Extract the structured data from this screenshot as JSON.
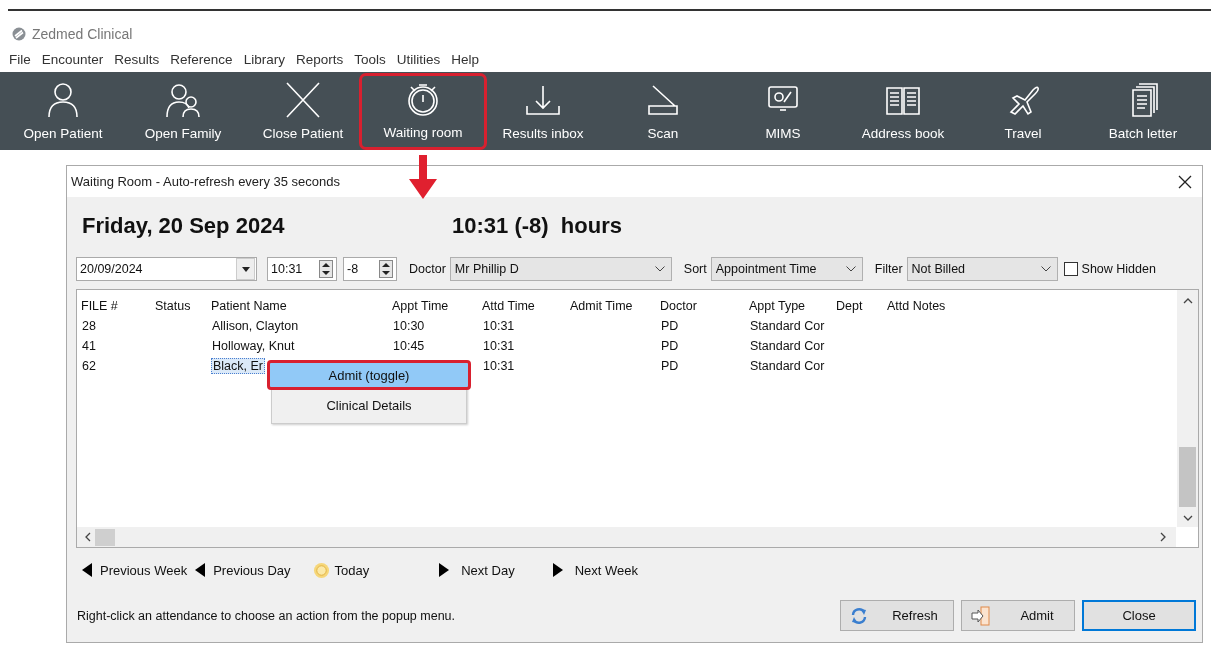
{
  "app": {
    "title": "Zedmed Clinical"
  },
  "menu": [
    "File",
    "Encounter",
    "Results",
    "Reference",
    "Library",
    "Reports",
    "Tools",
    "Utilities",
    "Help"
  ],
  "toolbar": [
    {
      "label": "Open Patient",
      "highlighted": false
    },
    {
      "label": "Open Family",
      "highlighted": false
    },
    {
      "label": "Close Patient",
      "highlighted": false
    },
    {
      "label": "Waiting room",
      "highlighted": true
    },
    {
      "label": "Results inbox",
      "highlighted": false
    },
    {
      "label": "Scan",
      "highlighted": false
    },
    {
      "label": "MIMS",
      "highlighted": false
    },
    {
      "label": "Address book",
      "highlighted": false
    },
    {
      "label": "Travel",
      "highlighted": false
    },
    {
      "label": "Batch letter",
      "highlighted": false
    }
  ],
  "dialog": {
    "title": "Waiting Room - Auto-refresh every 35 seconds",
    "date_heading": "Friday, 20 Sep 2024",
    "time_heading": "10:31 (-8)  hours",
    "date_field": {
      "value": "20/09/2024"
    },
    "time_field": {
      "value": "10:31"
    },
    "offset_field": {
      "value": "-8"
    },
    "doctor": {
      "label": "Doctor",
      "value": "Mr Phillip D"
    },
    "sort": {
      "label": "Sort",
      "value": "Appointment Time"
    },
    "filter": {
      "label": "Filter",
      "value": "Not Billed"
    },
    "show_hidden": {
      "label": "Show Hidden",
      "checked": false
    },
    "table": {
      "columns": [
        "FILE #",
        "Status",
        "Patient Name",
        "Appt Time",
        "Attd Time",
        "Admit Time",
        "Doctor",
        "Appt Type",
        "Dept",
        "Attd Notes"
      ],
      "rows": [
        {
          "file": "28",
          "patient_name": "Allison, Clayton",
          "appt_time": "10:30",
          "attd_time": "10:31",
          "doctor": "PD",
          "appt_type": "Standard Cor",
          "selected": false
        },
        {
          "file": "41",
          "patient_name": "Holloway, Knut",
          "appt_time": "10:45",
          "attd_time": "10:31",
          "doctor": "PD",
          "appt_type": "Standard Cor",
          "selected": false
        },
        {
          "file": "62",
          "patient_name": "Black, Er",
          "attd_time": "10:31",
          "doctor": "PD",
          "appt_type": "Standard Cor",
          "selected": true
        }
      ]
    },
    "context_menu": [
      {
        "label": "Admit (toggle)",
        "selected": true,
        "highlighted": true
      },
      {
        "label": "Clinical Details",
        "selected": false,
        "highlighted": false
      }
    ],
    "navigation": [
      {
        "label": "Previous Week",
        "kind": "back"
      },
      {
        "label": "Previous Day",
        "kind": "back"
      },
      {
        "label": "Today",
        "kind": "today"
      },
      {
        "label": "Next Day",
        "kind": "forward"
      },
      {
        "label": "Next Week",
        "kind": "forward"
      }
    ],
    "hint": "Right-click an attendance to choose an action from the popup menu.",
    "buttons": [
      {
        "label": "Refresh",
        "kind": "refresh",
        "default": false
      },
      {
        "label": "Admit",
        "kind": "admit",
        "default": false
      },
      {
        "label": "Close",
        "kind": "plain",
        "default": true
      }
    ]
  }
}
